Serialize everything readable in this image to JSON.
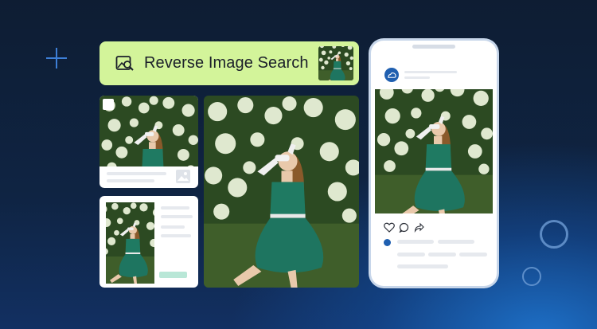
{
  "search": {
    "label": "Reverse Image Search",
    "icon": "image-search-icon"
  },
  "colors": {
    "background": "#0f2443",
    "accent_green": "#d3f49a",
    "brand_blue": "#1f5fb0"
  },
  "phone_post": {
    "actions": [
      "heart-icon",
      "comment-icon",
      "share-icon"
    ]
  }
}
